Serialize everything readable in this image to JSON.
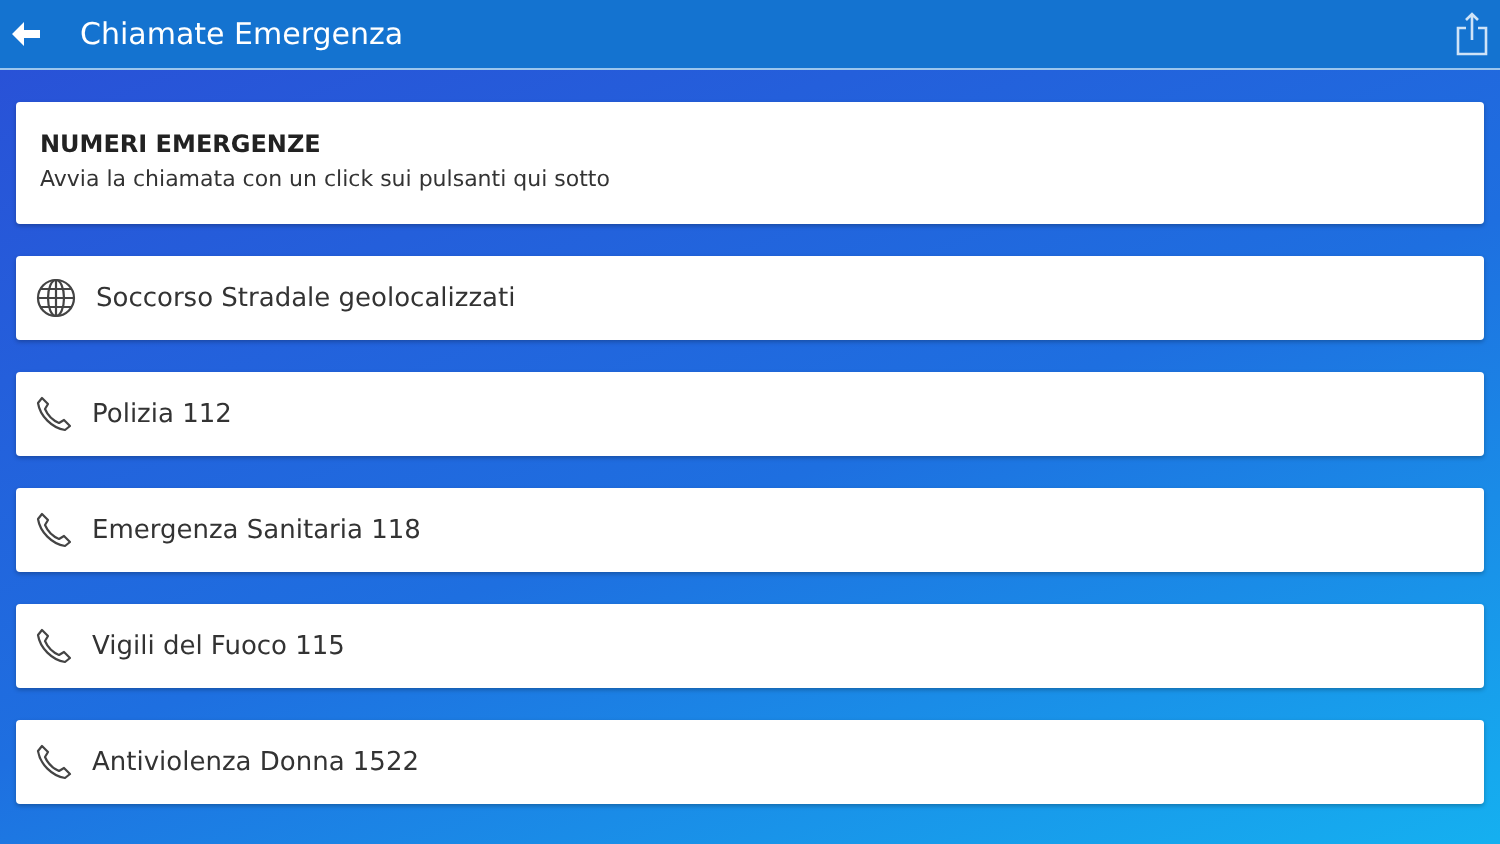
{
  "header": {
    "title": "Chiamate Emergenza"
  },
  "intro": {
    "title": "NUMERI EMERGENZE",
    "subtitle": "Avvia la chiamata con un click sui pulsanti qui sotto"
  },
  "items": [
    {
      "kind": "globe",
      "label": "Soccorso Stradale geolocalizzati"
    },
    {
      "kind": "phone",
      "label": "Polizia 112"
    },
    {
      "kind": "phone",
      "label": "Emergenza Sanitaria 118"
    },
    {
      "kind": "phone",
      "label": "Vigili del Fuoco 115"
    },
    {
      "kind": "phone",
      "label": "Antiviolenza Donna 1522"
    }
  ]
}
